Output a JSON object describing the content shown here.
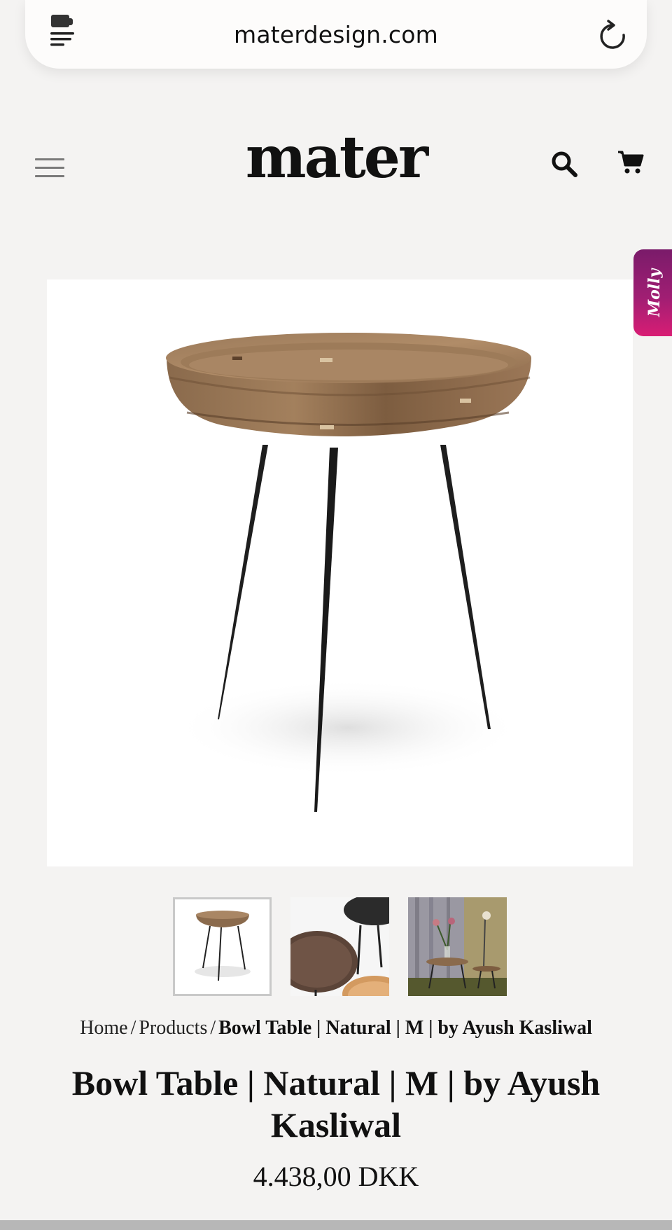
{
  "browser": {
    "url": "materdesign.com"
  },
  "header": {
    "logo": "mater"
  },
  "side_tab": {
    "label": "Molly",
    "color_start": "#7a1b6a",
    "color_end": "#d81d74"
  },
  "breadcrumb": {
    "items": [
      "Home",
      "Products",
      "Bowl Table | Natural | M | by Ayush Kasliwal"
    ],
    "separator": "/"
  },
  "product": {
    "title": "Bowl Table | Natural | M | by Ayush Kasliwal",
    "price": "4.438,00 DKK"
  },
  "gallery": {
    "selected_index": 0,
    "thumbnails": [
      "natural-bowl-table",
      "dark-and-light-bowl-tables",
      "bowl-tables-in-room"
    ]
  }
}
